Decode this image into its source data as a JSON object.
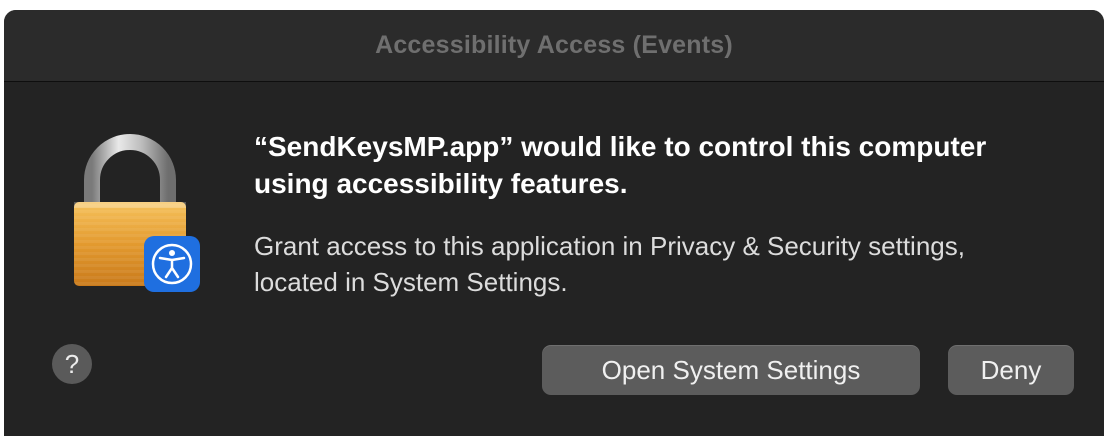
{
  "window": {
    "title": "Accessibility Access (Events)"
  },
  "dialog": {
    "headline": "“SendKeysMP.app” would like to control this computer using accessibility features.",
    "body": "Grant access to this application in Privacy & Security settings, located in System Settings.",
    "icon": "lock-with-accessibility-badge-icon"
  },
  "buttons": {
    "help_label": "?",
    "open_settings_label": "Open System Settings",
    "deny_label": "Deny"
  },
  "colors": {
    "background": "#232323",
    "titlebar": "#2b2b2b",
    "button": "#5c5c5c",
    "badge_blue": "#1f6fe0",
    "lock_gold": "#e8a33a"
  }
}
